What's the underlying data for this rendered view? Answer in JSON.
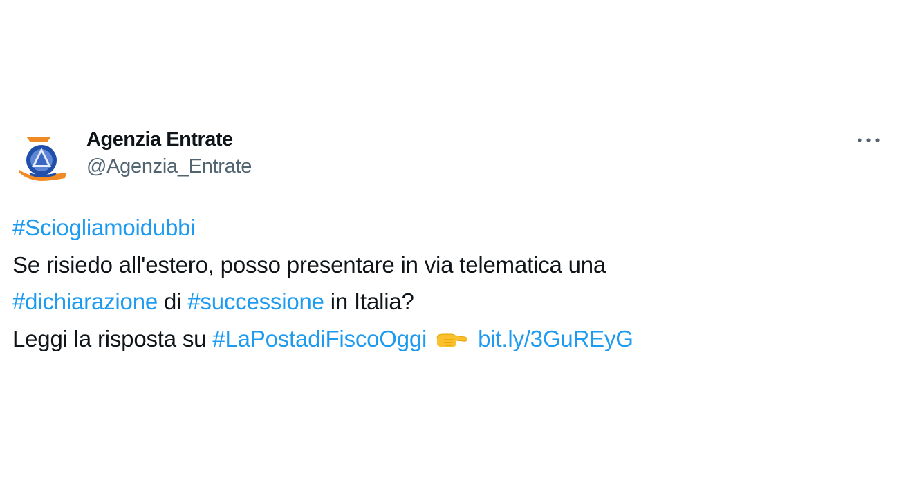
{
  "tweet": {
    "author": {
      "display_name": "Agenzia Entrate",
      "handle": "@Agenzia_Entrate"
    },
    "more_label": "More",
    "body": {
      "hashtag_1": "#Sciogliamoidubbi",
      "line_2": "Se risiedo all'estero, posso presentare in via telematica una",
      "hashtag_2": "#dichiarazione",
      "text_di": " di ",
      "hashtag_3": "#successione",
      "text_italia": " in Italia?",
      "text_leggi": "Leggi la risposta su ",
      "hashtag_4": "#LaPostadiFiscoOggi",
      "emoji": "backhand-index-pointing-right",
      "link": "bit.ly/3GuREyG"
    },
    "colors": {
      "link": "#1d9bf0",
      "text": "#0f1419",
      "secondary": "#536471",
      "logo_orange": "#f08a24",
      "logo_blue": "#1f4fa8"
    }
  }
}
